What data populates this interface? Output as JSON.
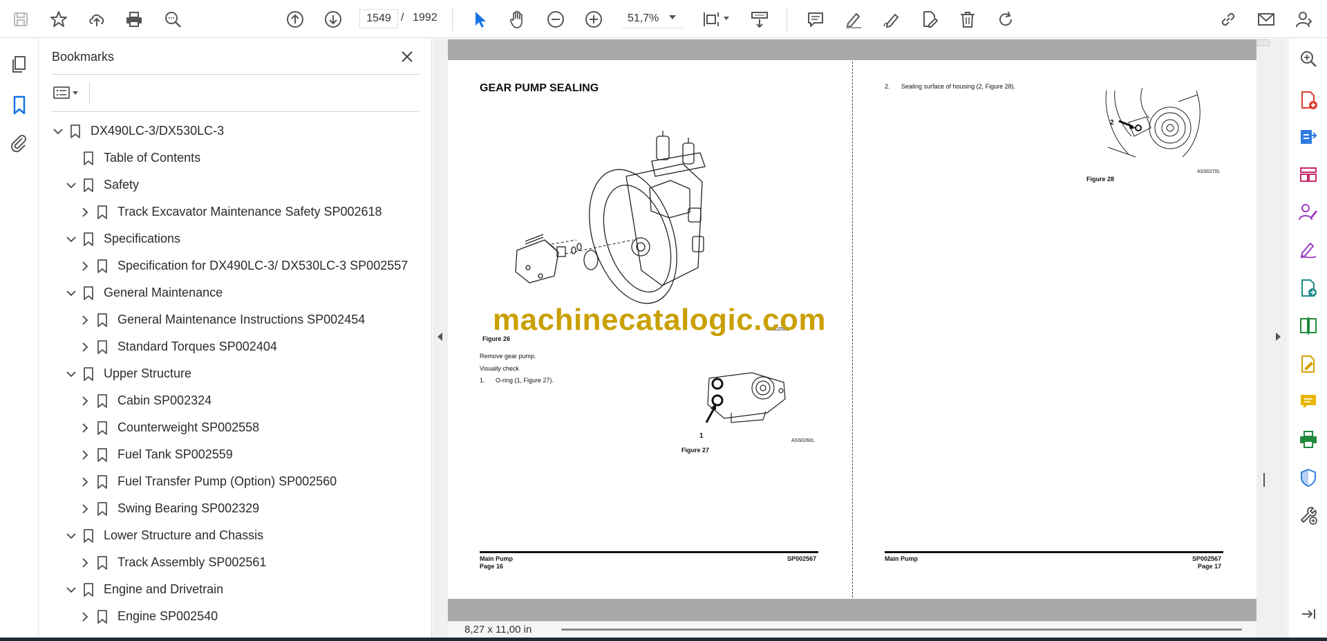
{
  "toolbar": {
    "current_page": "1549",
    "page_separator": "/",
    "total_pages": "1992",
    "zoom": "51,7%"
  },
  "bookmarks": {
    "title": "Bookmarks",
    "items": [
      {
        "label": "DX490LC-3/DX530LC-3",
        "level": 0,
        "state": "expanded"
      },
      {
        "label": "Table of Contents",
        "level": 1,
        "state": "leaf"
      },
      {
        "label": "Safety",
        "level": 1,
        "state": "expanded"
      },
      {
        "label": "Track Excavator Maintenance Safety SP002618",
        "level": 2,
        "state": "collapsed"
      },
      {
        "label": "Specifications",
        "level": 1,
        "state": "expanded"
      },
      {
        "label": "Specification for DX490LC-3/ DX530LC-3 SP002557",
        "level": 2,
        "state": "collapsed"
      },
      {
        "label": "General Maintenance",
        "level": 1,
        "state": "expanded"
      },
      {
        "label": "General Maintenance Instructions SP002454",
        "level": 2,
        "state": "collapsed"
      },
      {
        "label": "Standard Torques SP002404",
        "level": 2,
        "state": "collapsed"
      },
      {
        "label": "Upper Structure",
        "level": 1,
        "state": "expanded"
      },
      {
        "label": "Cabin SP002324",
        "level": 2,
        "state": "collapsed"
      },
      {
        "label": "Counterweight SP002558",
        "level": 2,
        "state": "collapsed"
      },
      {
        "label": "Fuel Tank SP002559",
        "level": 2,
        "state": "collapsed"
      },
      {
        "label": "Fuel Transfer Pump (Option) SP002560",
        "level": 2,
        "state": "collapsed"
      },
      {
        "label": "Swing Bearing SP002329",
        "level": 2,
        "state": "collapsed"
      },
      {
        "label": "Lower Structure and Chassis",
        "level": 1,
        "state": "expanded"
      },
      {
        "label": "Track Assembly SP002561",
        "level": 2,
        "state": "collapsed"
      },
      {
        "label": "Engine and Drivetrain",
        "level": 1,
        "state": "expanded"
      },
      {
        "label": "Engine SP002540",
        "level": 2,
        "state": "collapsed"
      }
    ]
  },
  "document": {
    "left_page": {
      "heading": "GEAR PUMP SEALING",
      "figure26_label": "Figure 26",
      "figure26_code": "ASS0250L",
      "step_remove": "Remove gear pump.",
      "step_visual": "Visually check",
      "item1_num": "1.",
      "item1_text": "O-ring (1, Figure 27).",
      "figure27_callout": "1",
      "figure27_label": "Figure 27",
      "figure27_code": "ASS0260L",
      "footer_left_title": "Main Pump",
      "footer_left_page": "Page 16",
      "footer_right_code": "SP002567"
    },
    "right_page": {
      "item2_num": "2.",
      "item2_text": "Sealing surface of housing (2, Figure 28).",
      "figure28_callout": "2",
      "figure28_label": "Figure 28",
      "figure28_code": "ASS0270L",
      "footer_left_title": "Main Pump",
      "footer_right_code": "SP002567",
      "footer_right_page": "Page 17"
    },
    "watermark": "machinecatalogic.com"
  },
  "status": {
    "page_size": "8,27 x 11,00 in"
  }
}
